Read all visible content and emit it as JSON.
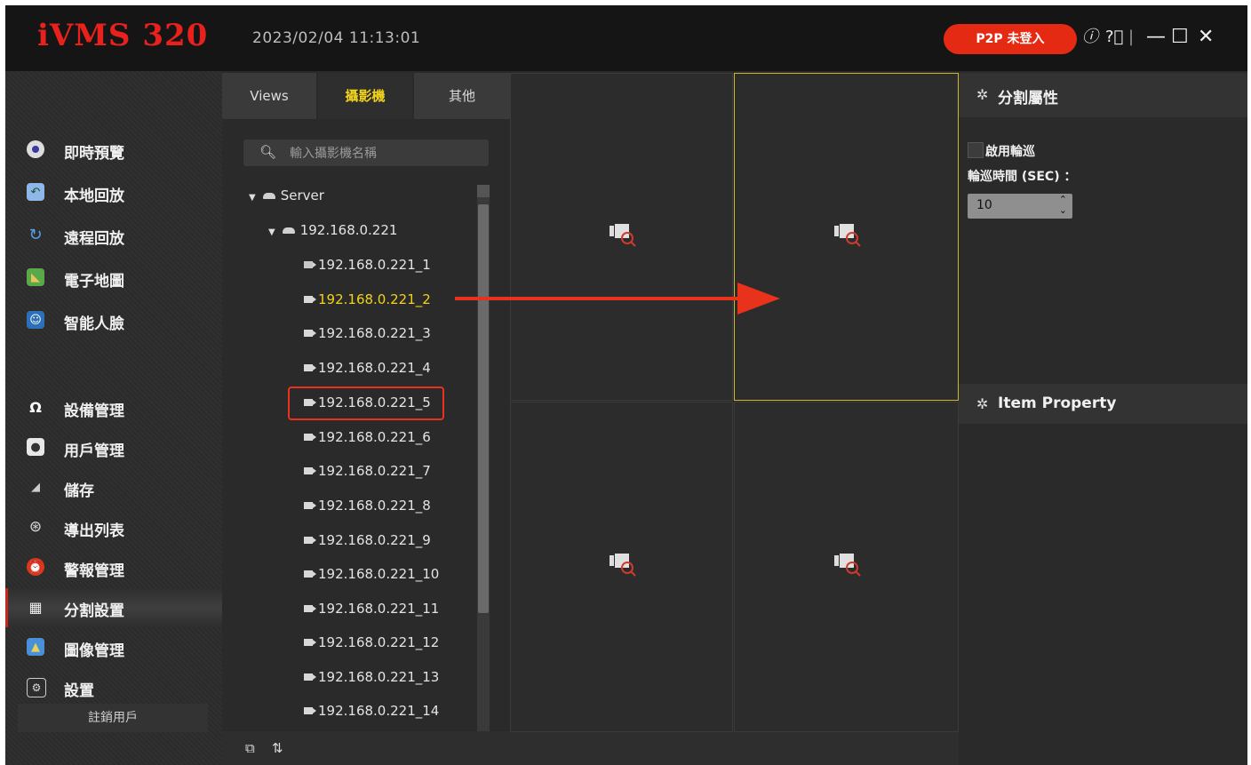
{
  "app": {
    "title": "iVMS 320",
    "datetime": "2023/02/04 11:13:01",
    "p2p_label": "P2P 未登入",
    "icons": {
      "info": "info-icon",
      "help": "help-icon",
      "minimize": "minimize-icon",
      "maximize": "maximize-icon",
      "close": "close-icon"
    }
  },
  "sidebar": {
    "items": [
      {
        "label": "即時預覽",
        "icon": "live-view-icon"
      },
      {
        "label": "本地回放",
        "icon": "local-playback-icon"
      },
      {
        "label": "遠程回放",
        "icon": "remote-playback-icon"
      },
      {
        "label": "電子地圖",
        "icon": "emap-icon"
      },
      {
        "label": "智能人臉",
        "icon": "face-icon"
      },
      {
        "label": "設備管理",
        "icon": "device-icon"
      },
      {
        "label": "用戶管理",
        "icon": "user-icon"
      },
      {
        "label": "儲存",
        "icon": "storage-icon"
      },
      {
        "label": "導出列表",
        "icon": "export-icon"
      },
      {
        "label": "警報管理",
        "icon": "alarm-icon"
      },
      {
        "label": "分割設置",
        "icon": "split-icon",
        "active": true
      },
      {
        "label": "圖像管理",
        "icon": "image-icon"
      },
      {
        "label": "設置",
        "icon": "settings-icon"
      }
    ],
    "logout_label": "註銷用戶"
  },
  "camera_panel": {
    "tabs": [
      "Views",
      "攝影機",
      "其他"
    ],
    "active_tab": "攝影機",
    "search_placeholder": "輸入攝影機名稱",
    "tree": {
      "server": "Server",
      "device": "192.168.0.221",
      "cameras": [
        "192.168.0.221_1",
        "192.168.0.221_2",
        "192.168.0.221_3",
        "192.168.0.221_4",
        "192.168.0.221_5",
        "192.168.0.221_6",
        "192.168.0.221_7",
        "192.168.0.221_8",
        "192.168.0.221_9",
        "192.168.0.221_10",
        "192.168.0.221_11",
        "192.168.0.221_12",
        "192.168.0.221_13",
        "192.168.0.221_14"
      ],
      "selected_camera": "192.168.0.221_2"
    }
  },
  "right_panel": {
    "split_properties_title": "分割屬性",
    "enable_tour_label": "啟用輪巡",
    "tour_time_label": "輪巡時間 (SEC) ：",
    "tour_time_value": "10",
    "item_property_title": "Item Property"
  },
  "colors": {
    "accent_red": "#e52a14",
    "selected_yellow": "#f2d21a"
  }
}
